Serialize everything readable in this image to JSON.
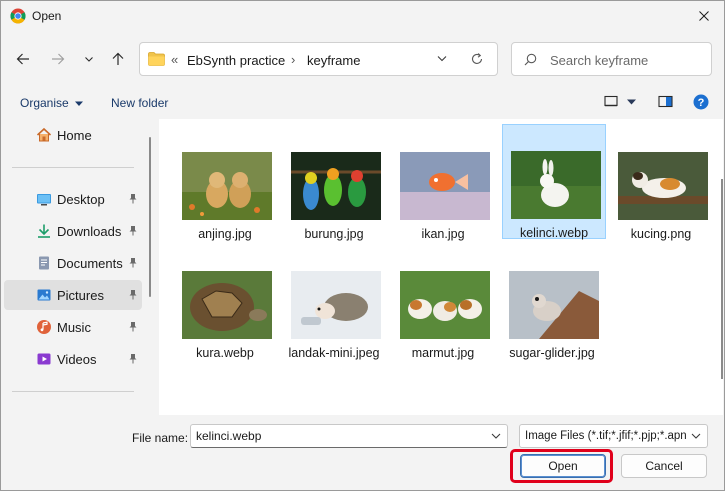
{
  "window": {
    "title": "Open"
  },
  "address": {
    "prefix": "«",
    "crumbs": [
      "EbSynth practice",
      "keyframe"
    ],
    "separator": "›"
  },
  "search": {
    "placeholder": "Search keyframe",
    "value": ""
  },
  "toolbar": {
    "organise": "Organise",
    "new_folder": "New folder"
  },
  "sidebar": {
    "items": [
      {
        "label": "Home",
        "icon": "home-icon"
      },
      {
        "label": "Desktop",
        "icon": "desktop-icon",
        "pinned": true
      },
      {
        "label": "Downloads",
        "icon": "download-icon",
        "pinned": true
      },
      {
        "label": "Documents",
        "icon": "document-icon",
        "pinned": true
      },
      {
        "label": "Pictures",
        "icon": "pictures-icon",
        "pinned": true,
        "active": true
      },
      {
        "label": "Music",
        "icon": "music-icon",
        "pinned": true
      },
      {
        "label": "Videos",
        "icon": "video-icon",
        "pinned": true
      }
    ]
  },
  "files": [
    {
      "name": "anjing.jpg"
    },
    {
      "name": "burung.jpg"
    },
    {
      "name": "ikan.jpg"
    },
    {
      "name": "kelinci.webp",
      "selected": true
    },
    {
      "name": "kucing.png"
    },
    {
      "name": "kura.webp"
    },
    {
      "name": "landak-mini.jpeg"
    },
    {
      "name": "marmut.jpg"
    },
    {
      "name": "sugar-glider.jpg"
    }
  ],
  "footer": {
    "file_name_label": "File name:",
    "file_name_value": "kelinci.webp",
    "file_type": "Image Files (*.tif;*.jfif;*.pjp;*.apng",
    "open_label": "Open",
    "cancel_label": "Cancel"
  },
  "colors": {
    "accent": "#0067c0",
    "selection": "#cce8ff",
    "highlight": "#e0001b"
  }
}
